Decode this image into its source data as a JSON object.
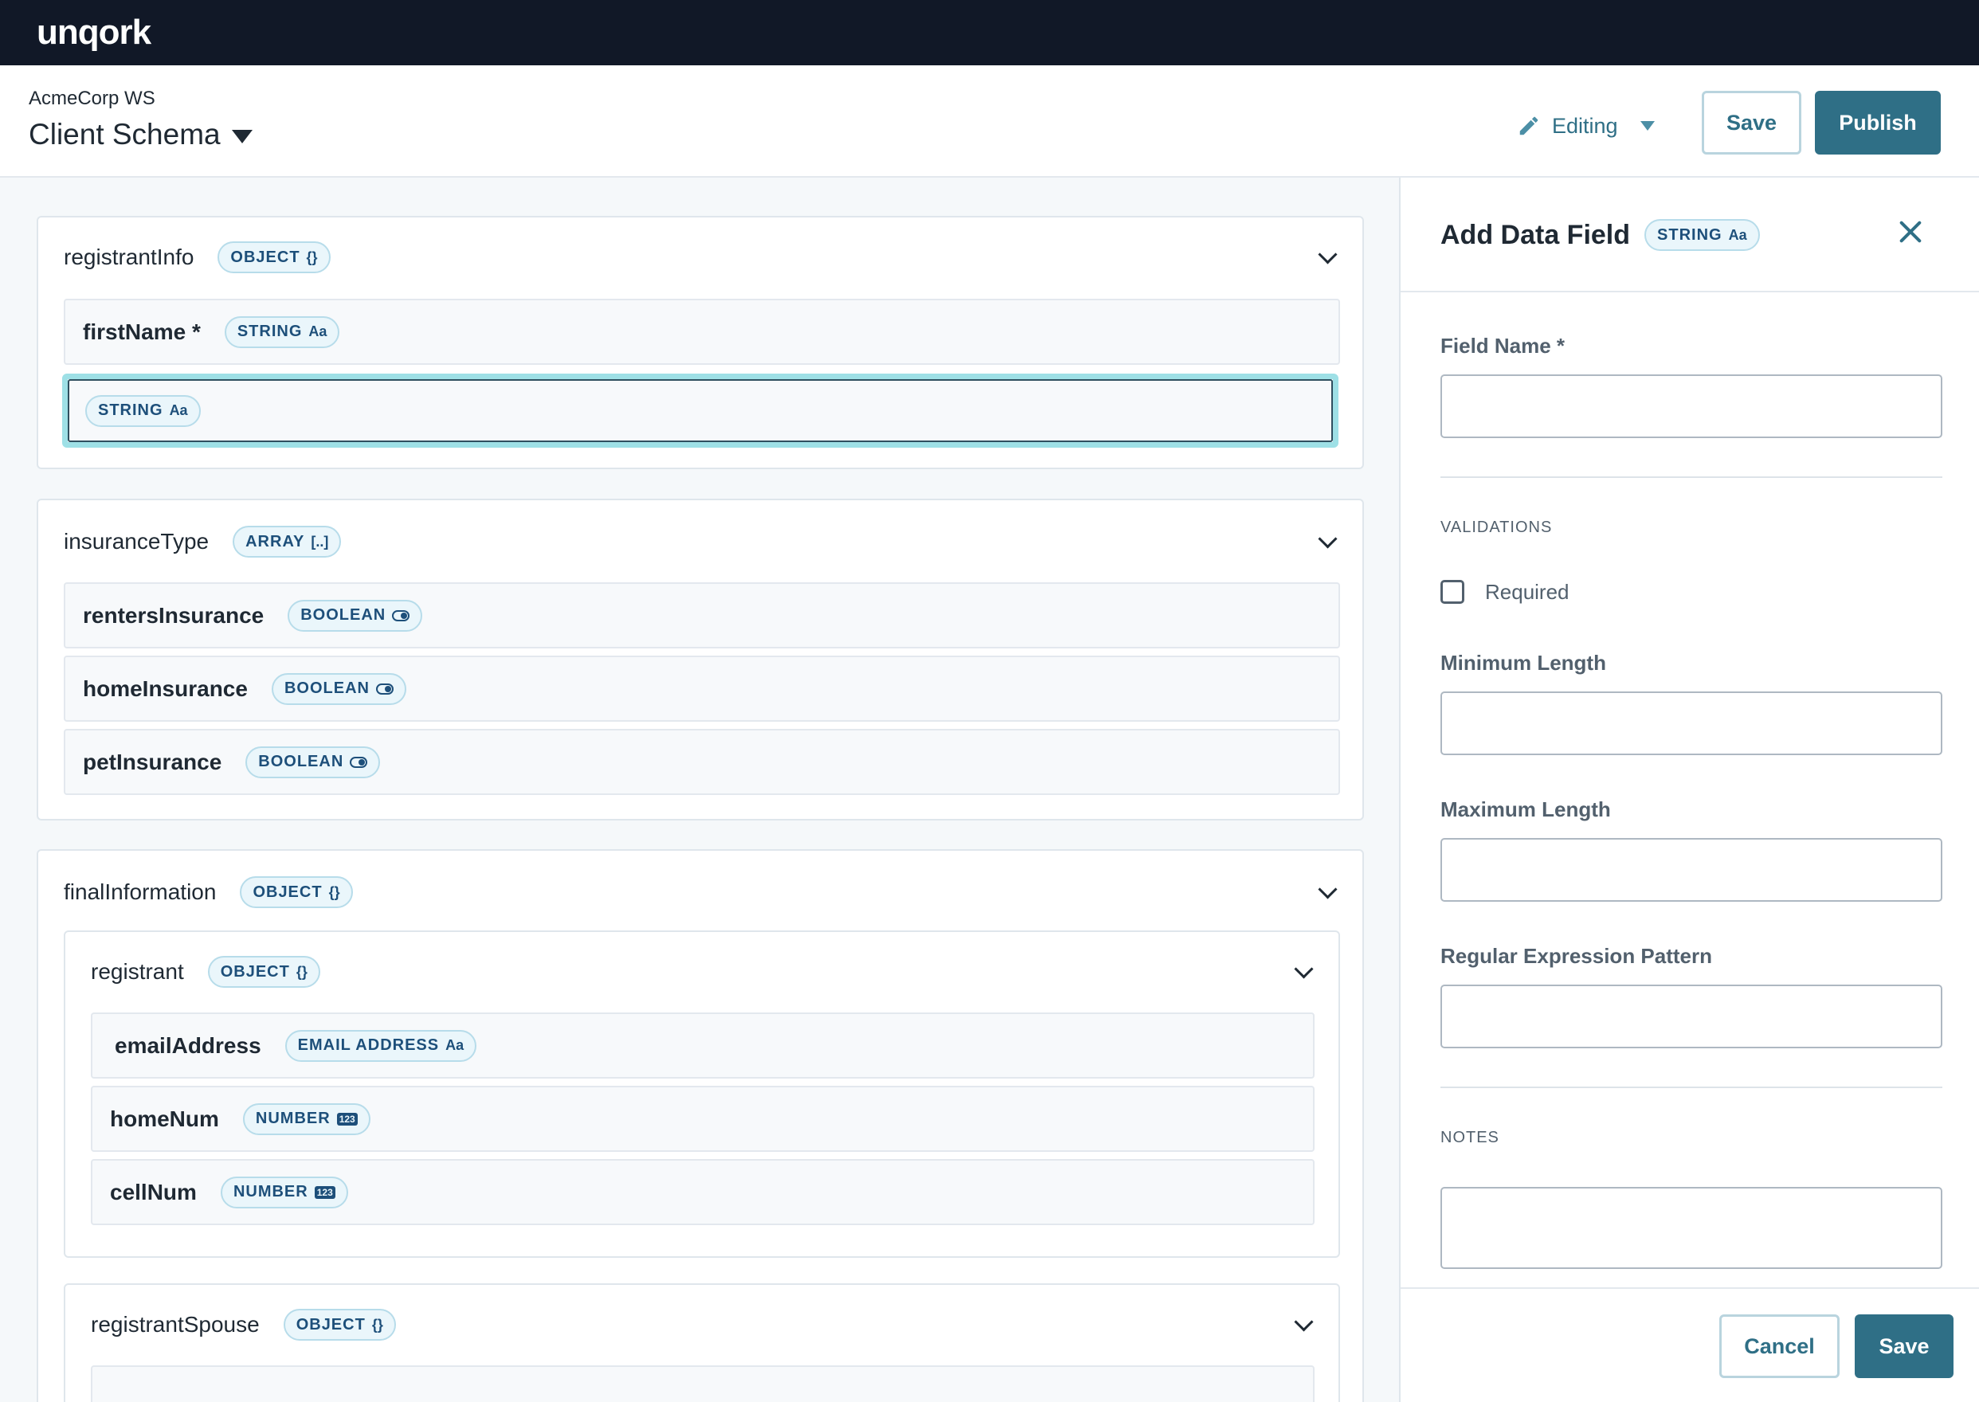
{
  "app": {
    "logo": "unqork"
  },
  "header": {
    "workspace": "AcmeCorp WS",
    "title": "Client Schema",
    "mode_label": "Editing",
    "save_label": "Save",
    "publish_label": "Publish"
  },
  "schema": {
    "registrantInfo": {
      "name": "registrantInfo",
      "type": "OBJECT",
      "type_icon": "{}",
      "fields": [
        {
          "name": "firstName *",
          "type": "STRING",
          "icon": "Aa"
        }
      ],
      "selected_field": {
        "type": "STRING",
        "icon": "Aa"
      }
    },
    "insuranceType": {
      "name": "insuranceType",
      "type": "ARRAY",
      "type_icon": "[..]",
      "fields": [
        {
          "name": "rentersInsurance",
          "type": "BOOLEAN"
        },
        {
          "name": "homeInsurance",
          "type": "BOOLEAN"
        },
        {
          "name": "petInsurance",
          "type": "BOOLEAN"
        }
      ]
    },
    "finalInformation": {
      "name": "finalInformation",
      "type": "OBJECT",
      "type_icon": "{}",
      "registrant": {
        "name": "registrant",
        "type": "OBJECT",
        "type_icon": "{}",
        "fields": [
          {
            "name": "emailAddress",
            "type": "EMAIL ADDRESS",
            "icon": "Aa"
          },
          {
            "name": "homeNum",
            "type": "NUMBER",
            "icon": "123"
          },
          {
            "name": "cellNum",
            "type": "NUMBER",
            "icon": "123"
          }
        ]
      },
      "registrantSpouse": {
        "name": "registrantSpouse",
        "type": "OBJECT",
        "type_icon": "{}"
      }
    }
  },
  "panel": {
    "title": "Add Data Field",
    "type": "STRING",
    "type_icon": "Aa",
    "field_name_label": "Field Name *",
    "field_name_value": "",
    "validations_label": "VALIDATIONS",
    "required_label": "Required",
    "min_length_label": "Minimum Length",
    "min_length_value": "",
    "max_length_label": "Maximum Length",
    "max_length_value": "",
    "regex_label": "Regular Expression Pattern",
    "regex_value": "",
    "notes_label": "NOTES",
    "notes_value": "",
    "cancel_label": "Cancel",
    "save_label": "Save"
  },
  "colors": {
    "topbar": "#111827",
    "accent": "#2f6f86",
    "badge_bg": "#eaf6fb",
    "badge_text": "#1d4f7a",
    "selection": "#9ee0e6"
  }
}
